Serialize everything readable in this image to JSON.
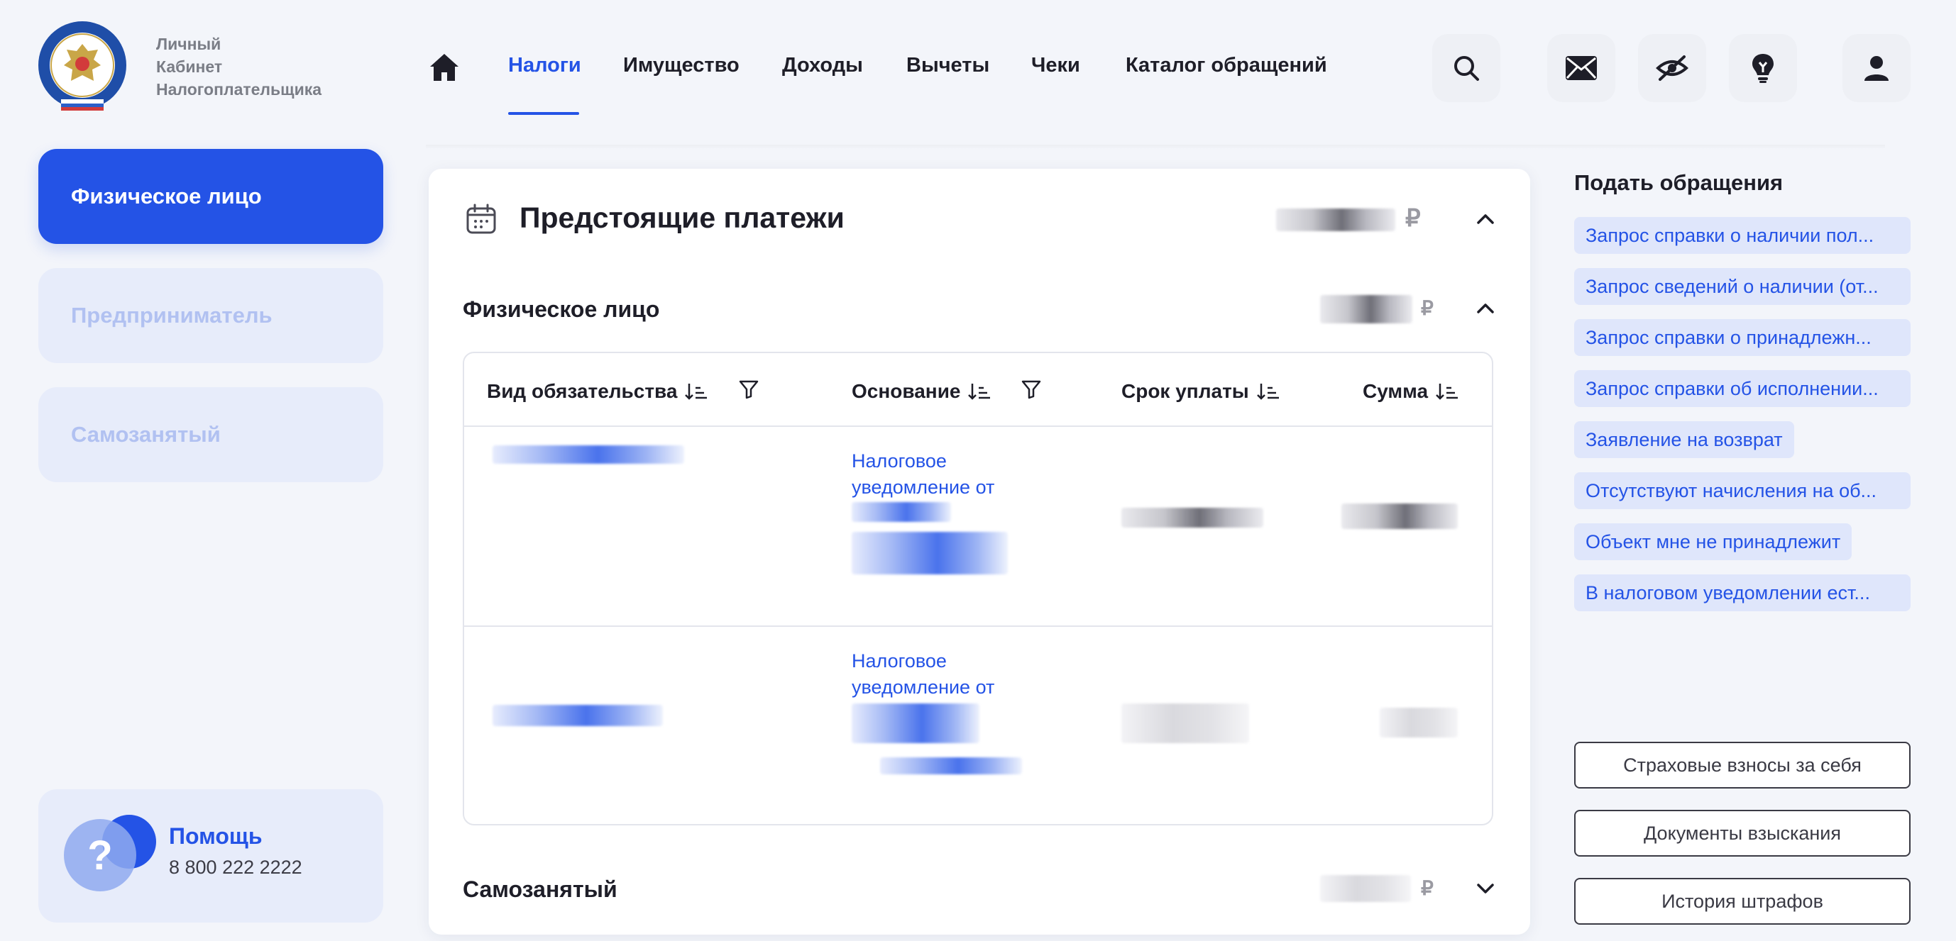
{
  "header": {
    "logo_title": [
      "Личный",
      "Кабинет",
      "Налогоплательщика"
    ],
    "nav": [
      {
        "label": "Налоги",
        "active": true
      },
      {
        "label": "Имущество",
        "active": false
      },
      {
        "label": "Доходы",
        "active": false
      },
      {
        "label": "Вычеты",
        "active": false
      },
      {
        "label": "Чеки",
        "active": false
      },
      {
        "label": "Каталог обращений",
        "active": false
      }
    ],
    "icons": [
      "home-icon",
      "search-icon",
      "mail-icon",
      "eye-off-icon",
      "lightbulb-icon",
      "user-icon"
    ]
  },
  "sidebar": {
    "tabs": [
      {
        "label": "Физическое лицо",
        "active": true
      },
      {
        "label": "Предприниматель",
        "active": false
      },
      {
        "label": "Самозанятый",
        "active": false
      }
    ],
    "help": {
      "title": "Помощь",
      "phone": "8 800 222 2222",
      "icon": "question-icon"
    }
  },
  "main": {
    "title": "Предстоящие платежи",
    "currency": "₽",
    "sections": [
      {
        "title": "Физическое лицо",
        "expanded": true
      },
      {
        "title": "Самозанятый",
        "expanded": false
      }
    ],
    "table": {
      "columns": [
        "Вид обязательства",
        "Основание",
        "Срок уплаты",
        "Сумма"
      ],
      "rows": [
        {
          "basis": "Налоговое уведомление от"
        },
        {
          "basis": "Налоговое уведомление от"
        }
      ]
    }
  },
  "right_panel": {
    "title": "Подать обращения",
    "links": [
      "Запрос справки о наличии пол...",
      "Запрос сведений о наличии (от...",
      "Запрос справки о принадлежн...",
      "Запрос справки об исполнении...",
      "Заявление на возврат",
      "Отсутствуют начисления на об...",
      "Объект мне не принадлежит",
      "В налоговом уведомлении ест..."
    ],
    "buttons": [
      "Страховые взносы за себя",
      "Документы взыскания",
      "История штрафов"
    ]
  },
  "colors": {
    "accent": "#2453e6",
    "accent_light": "#e7ecfa",
    "text": "#1e1e28",
    "background": "#f3f5fa"
  }
}
